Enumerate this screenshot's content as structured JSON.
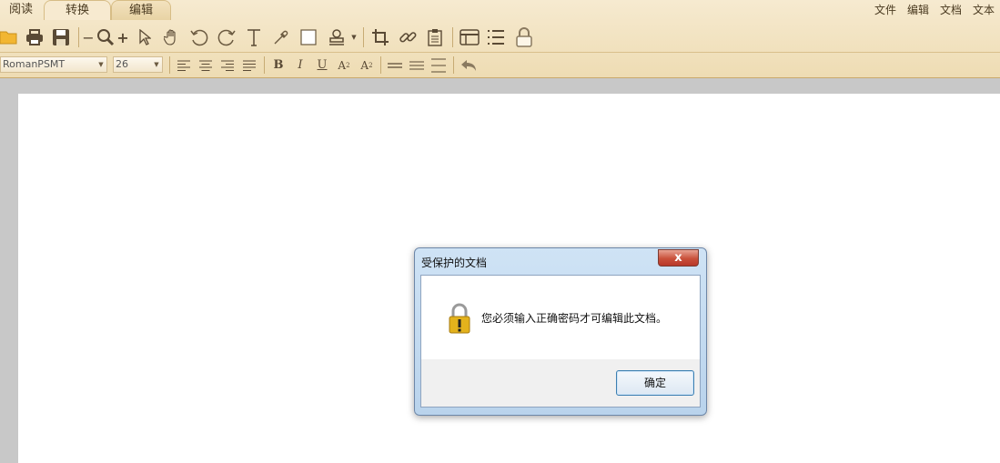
{
  "tabs": [
    {
      "label": "阅读"
    },
    {
      "label": "转换"
    },
    {
      "label": "编辑"
    }
  ],
  "top_menu": [
    {
      "label": "文件"
    },
    {
      "label": "编辑"
    },
    {
      "label": "文档"
    },
    {
      "label": "文本"
    }
  ],
  "format_bar": {
    "font_name": "RomanPSMT",
    "font_size": "26",
    "bold_label": "B",
    "italic_label": "I",
    "underline_label": "U",
    "superscript_label": "A",
    "superscript_mark": "2",
    "subscript_label": "A",
    "subscript_mark": "2"
  },
  "dialog": {
    "title": "受保护的文档",
    "close_label": "x",
    "message": "您必须输入正确密码才可编辑此文档。",
    "ok_label": "确定"
  },
  "colors": {
    "ribbon": "#eedcb3",
    "icon": "#5a4a35",
    "dialog_frame": "#b9d3ec",
    "close_button": "#c9503a",
    "lock_gold": "#e3b21c"
  }
}
